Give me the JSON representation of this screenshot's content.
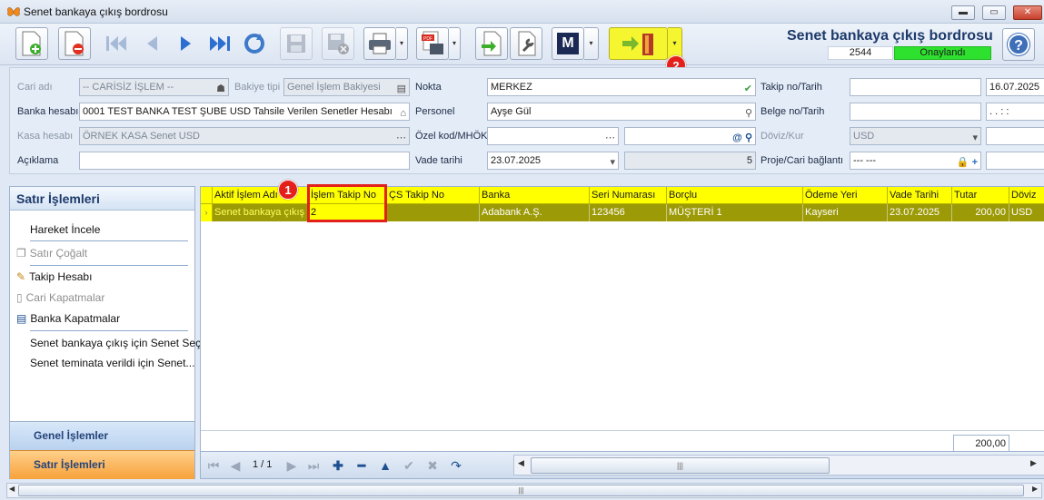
{
  "window": {
    "title": "Senet bankaya çıkış bordrosu",
    "minimize": "▬",
    "maximize": "▭",
    "close": "✕"
  },
  "header": {
    "title": "Senet bankaya çıkış bordrosu",
    "doc_no": "2544",
    "status": "Onaylandı",
    "status_color": "#2fe12f",
    "help": "?"
  },
  "toolbar": {
    "m_label": "M",
    "pdf_label": "PDF",
    "dropdown": "▾"
  },
  "badges": {
    "one": "1",
    "two": "2"
  },
  "form": {
    "cari_adi_label": "Cari adı",
    "cari_adi_value": "-- CARİSİZ İŞLEM --",
    "bakiye_tipi_label": "Bakiye tipi",
    "bakiye_tipi_value": "Genel İşlem Bakiyesi",
    "nokta_label": "Nokta",
    "nokta_value": "MERKEZ",
    "takip_label": "Takip no/Tarih",
    "takip_no": "",
    "takip_tarih": "16.07.2025",
    "banka_label": "Banka hesabı",
    "banka_value": "0001 TEST BANKA TEST ŞUBE USD Tahsile Verilen Senetler Hesabı",
    "personel_label": "Personel",
    "personel_value": "Ayşe Gül",
    "belge_label": "Belge no/Tarih",
    "belge_no": "",
    "belge_tarih": ". .  : :",
    "kasa_label": "Kasa hesabı",
    "kasa_value": "ÖRNEK KASA Senet USD",
    "ozel_label": "Özel kod/MHÖK",
    "ozel_value": "",
    "mhok_value": "",
    "doviz_label": "Döviz/Kur",
    "doviz_value": "USD",
    "kur_value": "",
    "aciklama_label": "Açıklama",
    "aciklama_value": "",
    "vade_label": "Vade tarihi",
    "vade_value": "23.07.2025",
    "vade_gun": "5",
    "proje_label": "Proje/Cari bağlantı",
    "proje_value": "--- ---",
    "proje_extra": ""
  },
  "left_panel": {
    "title": "Satır İşlemleri",
    "items": [
      "Hareket İncele",
      "Satır Çoğalt",
      "Takip Hesabı",
      "Cari Kapatmalar",
      "Banka Kapatmalar",
      "Senet bankaya çıkış için Senet Seç",
      "Senet teminata verildi için Senet..."
    ],
    "tabs": [
      "Genel İşlemler",
      "Satır İşlemleri"
    ]
  },
  "grid": {
    "columns": [
      "Aktif İşlem Adı",
      "İşlem Takip No",
      "ÇS Takip No",
      "Banka",
      "Seri Numarası",
      "Borçlu",
      "Ödeme Yeri",
      "Vade Tarihi",
      "Tutar",
      "Döviz"
    ],
    "rows": [
      [
        "Senet bankaya çıkış",
        "2",
        "",
        "Adabank A.Ş.",
        "123456",
        "MÜŞTERİ 1",
        "Kayseri",
        "23.07.2025",
        "200,00",
        "USD"
      ]
    ],
    "total": "200,00",
    "row_indicator": "›"
  },
  "nav": {
    "page": "1 / 1",
    "scroll_grip": "|||"
  }
}
